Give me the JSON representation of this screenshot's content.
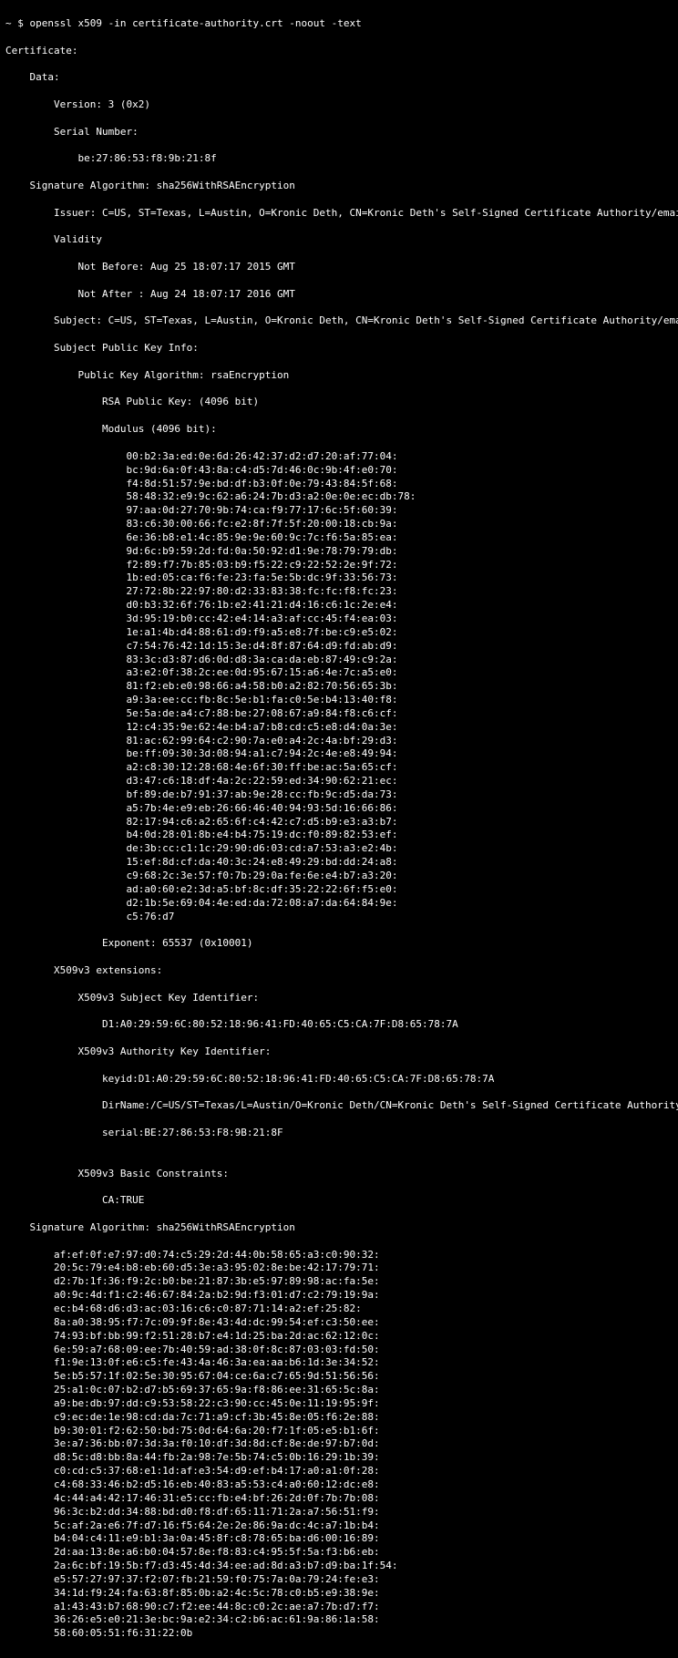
{
  "prompt": {
    "tilde": "~",
    "dollar": "$",
    "command": "openssl x509 -in certificate-authority.crt -noout -text"
  },
  "cert": {
    "header": "Certificate:",
    "data_label": "    Data:",
    "version": "        Version: 3 (0x2)",
    "serial_label": "        Serial Number:",
    "serial_value": "            be:27:86:53:f8:9b:21:8f",
    "sig_algo_top": "    Signature Algorithm: sha256WithRSAEncryption",
    "issuer": "        Issuer: C=US, ST=Texas, L=Austin, O=Kronic Deth, CN=Kronic Deth's Self-Signed Certificate Authority/emailAddress=Kronic.Deth@gmail.com",
    "validity_label": "        Validity",
    "not_before": "            Not Before: Aug 25 18:07:17 2015 GMT",
    "not_after": "            Not After : Aug 24 18:07:17 2016 GMT",
    "subject": "        Subject: C=US, ST=Texas, L=Austin, O=Kronic Deth, CN=Kronic Deth's Self-Signed Certificate Authority/emailAddress=Kronic.Deth@gmail.com",
    "spki_label": "        Subject Public Key Info:",
    "pka": "            Public Key Algorithm: rsaEncryption",
    "rsa_key": "                RSA Public Key: (4096 bit)",
    "modulus_label": "                Modulus (4096 bit):",
    "modulus": [
      "                    00:b2:3a:ed:0e:6d:26:42:37:d2:d7:20:af:77:04:",
      "                    bc:9d:6a:0f:43:8a:c4:d5:7d:46:0c:9b:4f:e0:70:",
      "                    f4:8d:51:57:9e:bd:df:b3:0f:0e:79:43:84:5f:68:",
      "                    58:48:32:e9:9c:62:a6:24:7b:d3:a2:0e:0e:ec:db:78:",
      "                    97:aa:0d:27:70:9b:74:ca:f9:77:17:6c:5f:60:39:",
      "                    83:c6:30:00:66:fc:e2:8f:7f:5f:20:00:18:cb:9a:",
      "                    6e:36:b8:e1:4c:85:9e:9e:60:9c:7c:f6:5a:85:ea:",
      "                    9d:6c:b9:59:2d:fd:0a:50:92:d1:9e:78:79:79:db:",
      "                    f2:89:f7:7b:85:03:b9:f5:22:c9:22:52:2e:9f:72:",
      "                    1b:ed:05:ca:f6:fe:23:fa:5e:5b:dc:9f:33:56:73:",
      "                    27:72:8b:22:97:80:d2:33:83:38:fc:fc:f8:fc:23:",
      "                    d0:b3:32:6f:76:1b:e2:41:21:d4:16:c6:1c:2e:e4:",
      "                    3d:95:19:b0:cc:42:e4:14:a3:af:cc:45:f4:ea:03:",
      "                    1e:a1:4b:d4:88:61:d9:f9:a5:e8:7f:be:c9:e5:02:",
      "                    c7:54:76:42:1d:15:3e:d4:8f:87:64:d9:fd:ab:d9:",
      "                    83:3c:d3:87:d6:0d:d8:3a:ca:da:eb:87:49:c9:2a:",
      "                    a3:e2:0f:38:2c:ee:0d:95:67:15:a6:4e:7c:a5:e0:",
      "                    81:f2:eb:e0:98:66:a4:58:b0:a2:82:70:56:65:3b:",
      "                    a9:3a:ee:cc:fb:8c:5e:b1:fa:c0:5e:b4:13:40:f8:",
      "                    5e:5a:de:a4:c7:88:be:27:08:67:a9:84:f8:c6:cf:",
      "                    12:c4:35:9e:62:4e:b4:a7:b8:cd:c5:e8:d4:0a:3e:",
      "                    81:ac:62:99:64:c2:90:7a:e0:a4:2c:4a:bf:29:d3:",
      "                    be:ff:09:30:3d:08:94:a1:c7:94:2c:4e:e8:49:94:",
      "                    a2:c8:30:12:28:68:4e:6f:30:ff:be:ac:5a:65:cf:",
      "                    d3:47:c6:18:df:4a:2c:22:59:ed:34:90:62:21:ec:",
      "                    bf:89:de:b7:91:37:ab:9e:28:cc:fb:9c:d5:da:73:",
      "                    a5:7b:4e:e9:eb:26:66:46:40:94:93:5d:16:66:86:",
      "                    82:17:94:c6:a2:65:6f:c4:42:c7:d5:b9:e3:a3:b7:",
      "                    b4:0d:28:01:8b:e4:b4:75:19:dc:f0:89:82:53:ef:",
      "                    de:3b:cc:c1:1c:29:90:d6:03:cd:a7:53:a3:e2:4b:",
      "                    15:ef:8d:cf:da:40:3c:24:e8:49:29:bd:dd:24:a8:",
      "                    c9:68:2c:3e:57:f0:7b:29:0a:fe:6e:e4:b7:a3:20:",
      "                    ad:a0:60:e2:3d:a5:bf:8c:df:35:22:22:6f:f5:e0:",
      "                    d2:1b:5e:69:04:4e:ed:da:72:08:a7:da:64:84:9e:",
      "                    c5:76:d7"
    ],
    "exponent": "                Exponent: 65537 (0x10001)",
    "ext_label": "        X509v3 extensions:",
    "ski_label": "            X509v3 Subject Key Identifier: ",
    "ski_value": "                D1:A0:29:59:6C:80:52:18:96:41:FD:40:65:C5:CA:7F:D8:65:78:7A",
    "aki_label": "            X509v3 Authority Key Identifier: ",
    "aki_keyid": "                keyid:D1:A0:29:59:6C:80:52:18:96:41:FD:40:65:C5:CA:7F:D8:65:78:7A",
    "aki_dirname": "                DirName:/C=US/ST=Texas/L=Austin/O=Kronic Deth/CN=Kronic Deth's Self-Signed Certificate Authority/emailAddress=Kronic.Deth@gmail.com",
    "aki_serial": "                serial:BE:27:86:53:F8:9B:21:8F",
    "blank": "",
    "bc_label": "            X509v3 Basic Constraints: ",
    "bc_value": "                CA:TRUE",
    "sig_algo_bottom": "    Signature Algorithm: sha256WithRSAEncryption",
    "signature": [
      "        af:ef:0f:e7:97:d0:74:c5:29:2d:44:0b:58:65:a3:c0:90:32:",
      "        20:5c:79:e4:b8:eb:60:d5:3e:a3:95:02:8e:be:42:17:79:71:",
      "        d2:7b:1f:36:f9:2c:b0:be:21:87:3b:e5:97:89:98:ac:fa:5e:",
      "        a0:9c:4d:f1:c2:46:67:84:2a:b2:9d:f3:01:d7:c2:79:19:9a:",
      "        ec:b4:68:d6:d3:ac:03:16:c6:c0:87:71:14:a2:ef:25:82:",
      "        8a:a0:38:95:f7:7c:09:9f:8e:43:4d:dc:99:54:ef:c3:50:ee:",
      "        74:93:bf:bb:99:f2:51:28:b7:e4:1d:25:ba:2d:ac:62:12:0c:",
      "        6e:59:a7:68:09:ee:7b:40:59:ad:38:0f:8c:87:03:03:fd:50:",
      "        f1:9e:13:0f:e6:c5:fe:43:4a:46:3a:ea:aa:b6:1d:3e:34:52:",
      "        5e:b5:57:1f:02:5e:30:95:67:04:ce:6a:c7:65:9d:51:56:56:",
      "        25:a1:0c:07:b2:d7:b5:69:37:65:9a:f8:86:ee:31:65:5c:8a:",
      "        a9:be:db:97:dd:c9:53:58:22:c3:90:cc:45:0e:11:19:95:9f:",
      "        c9:ec:de:1e:98:cd:da:7c:71:a9:cf:3b:45:8e:05:f6:2e:88:",
      "        b9:30:01:f2:62:50:bd:75:0d:64:6a:20:f7:1f:05:e5:b1:6f:",
      "        3e:a7:36:bb:07:3d:3a:f0:10:df:3d:8d:cf:8e:de:97:b7:0d:",
      "        d8:5c:d8:bb:8a:44:fb:2a:98:7e:5b:74:c5:0b:16:29:1b:39:",
      "        c0:cd:c5:37:68:e1:1d:af:e3:54:d9:ef:b4:17:a0:a1:0f:28:",
      "        c4:68:33:46:b2:d5:16:eb:40:83:a5:53:c4:a0:60:12:dc:e8:",
      "        4c:44:a4:42:17:46:31:e5:cc:fb:e4:bf:26:2d:0f:7b:7b:08:",
      "        96:3c:b2:dd:34:88:bd:d0:f8:df:65:11:71:2a:a7:56:51:f9:",
      "        5c:af:2a:e6:7f:d7:16:f5:64:2e:2e:86:9a:dc:4c:a7:1b:b4:",
      "        b4:04:c4:11:e9:b1:3a:0a:45:8f:c8:78:65:ba:d6:00:16:89:",
      "        2d:aa:13:8e:a6:b0:04:57:8e:f8:83:c4:95:5f:5a:f3:b6:eb:",
      "        2a:6c:bf:19:5b:f7:d3:45:4d:34:ee:ad:8d:a3:b7:d9:ba:1f:54:",
      "        e5:57:27:97:37:f2:07:fb:21:59:f0:75:7a:0a:79:24:fe:e3:",
      "        34:1d:f9:24:fa:63:8f:85:0b:a2:4c:5c:78:c0:b5:e9:38:9e:",
      "        a1:43:43:b7:68:90:c7:f2:ee:44:8c:c0:2c:ae:a7:7b:d7:f7:",
      "        36:26:e5:e0:21:3e:bc:9a:e2:34:c2:b6:ac:61:9a:86:1a:58:",
      "        58:60:05:51:f6:31:22:0b"
    ]
  }
}
